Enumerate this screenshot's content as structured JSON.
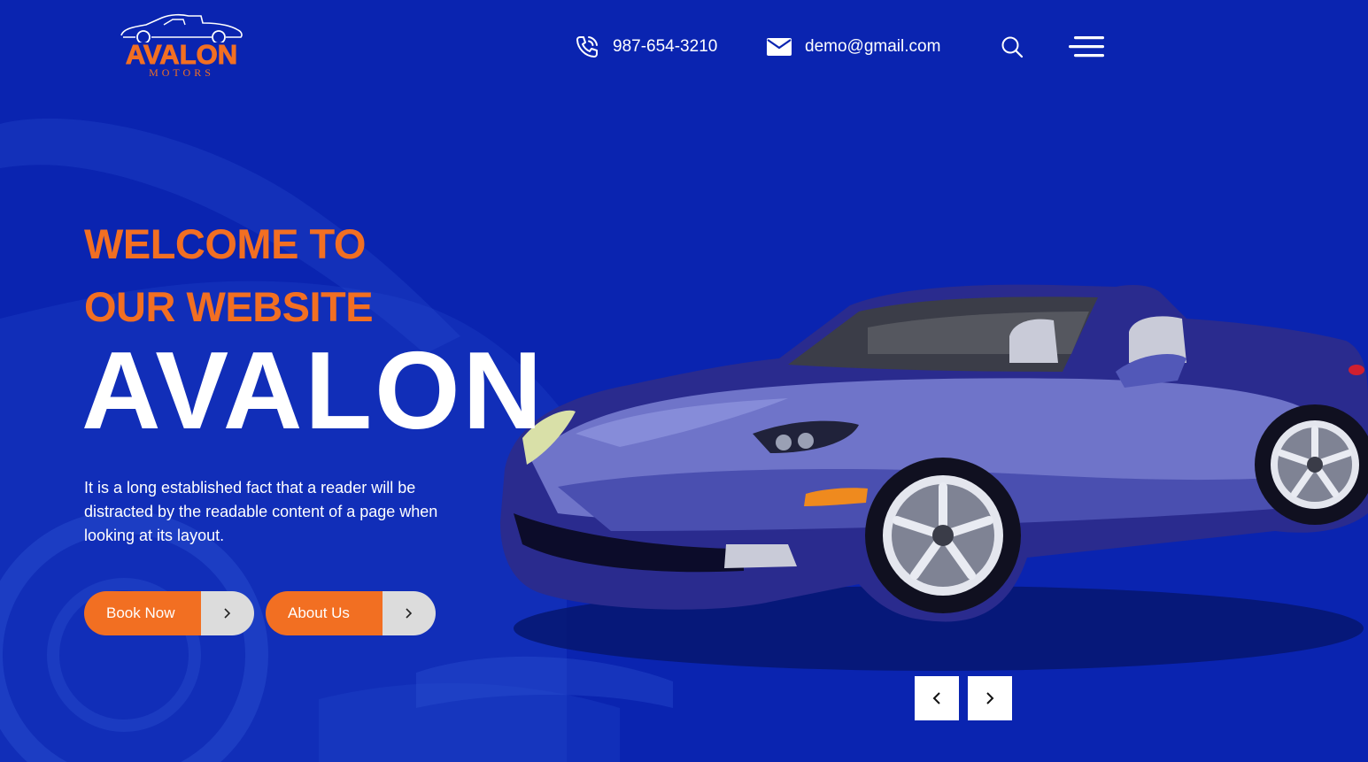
{
  "brand": {
    "logo_name": "AVALON",
    "logo_tagline": "MOTORS",
    "accent_color": "#f26f22",
    "background_color": "#0a24b0"
  },
  "header": {
    "phone": "987-654-3210",
    "email": "demo@gmail.com",
    "phone_icon": "phone-icon",
    "mail_icon": "mail-icon",
    "search_icon": "search-icon",
    "menu_icon": "hamburger-menu-icon"
  },
  "hero": {
    "pre_title_line1": "WELCOME TO",
    "pre_title_line2": "OUR WEBSITE",
    "title": "AVALON",
    "description": "It is a long established fact that a reader will be distracted by the readable content of a page when looking at its layout."
  },
  "buttons": {
    "book_now": "Book Now",
    "about_us": "About Us"
  },
  "slider": {
    "prev_icon": "chevron-left-icon",
    "next_icon": "chevron-right-icon"
  }
}
